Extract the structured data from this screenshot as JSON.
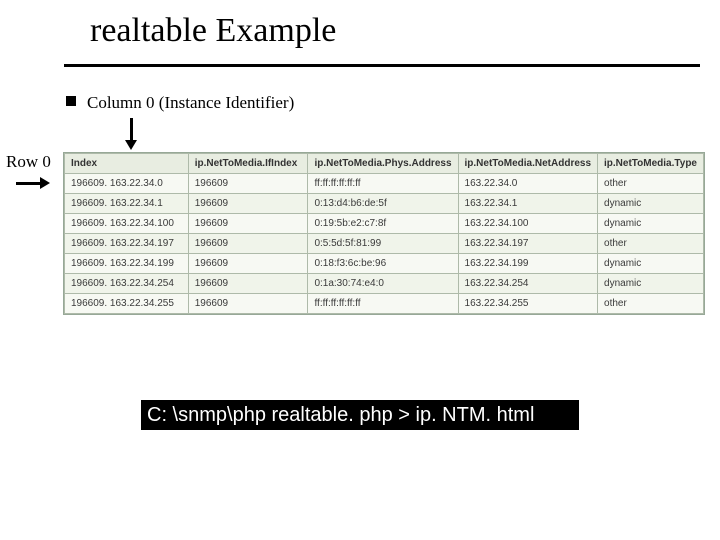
{
  "title": "realtable Example",
  "column_label": "Column 0 (Instance Identifier)",
  "row_label": "Row 0",
  "command": "C: \\snmp\\php realtable. php > ip. NTM. html",
  "table": {
    "headers": [
      "Index",
      "ip.NetToMedia.IfIndex",
      "ip.NetToMedia.Phys.Address",
      "ip.NetToMedia.NetAddress",
      "ip.NetToMedia.Type"
    ],
    "rows": [
      [
        "196609. 163.22.34.0",
        "196609",
        "ff:ff:ff:ff:ff:ff",
        "163.22.34.0",
        "other"
      ],
      [
        "196609. 163.22.34.1",
        "196609",
        "0:13:d4:b6:de:5f",
        "163.22.34.1",
        "dynamic"
      ],
      [
        "196609. 163.22.34.100",
        "196609",
        "0:19:5b:e2:c7:8f",
        "163.22.34.100",
        "dynamic"
      ],
      [
        "196609. 163.22.34.197",
        "196609",
        "0:5:5d:5f:81:99",
        "163.22.34.197",
        "other"
      ],
      [
        "196609. 163.22.34.199",
        "196609",
        "0:18:f3:6c:be:96",
        "163.22.34.199",
        "dynamic"
      ],
      [
        "196609. 163.22.34.254",
        "196609",
        "0:1a:30:74:e4:0",
        "163.22.34.254",
        "dynamic"
      ],
      [
        "196609. 163.22.34.255",
        "196609",
        "ff:ff:ff:ff:ff:ff",
        "163.22.34.255",
        "other"
      ]
    ]
  }
}
